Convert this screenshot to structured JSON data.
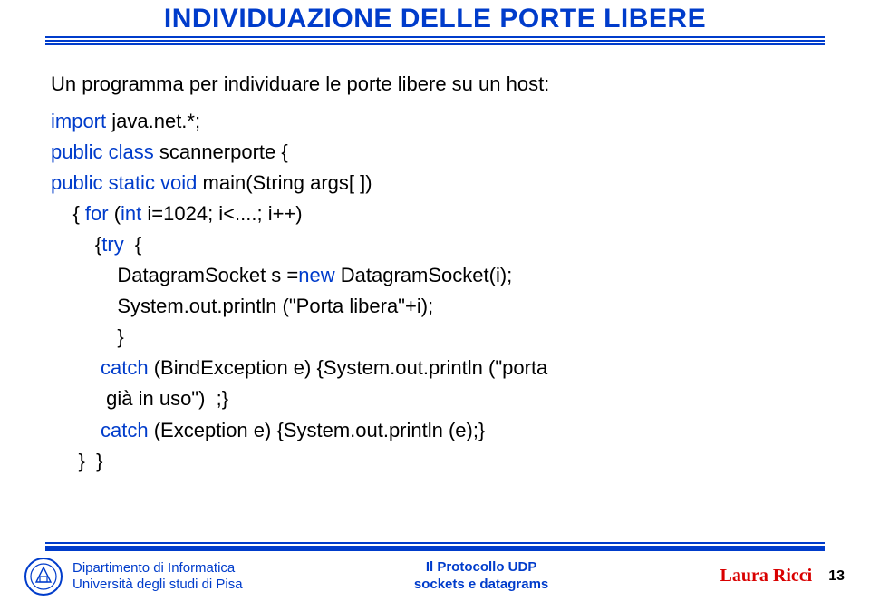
{
  "title": "INDIVIDUAZIONE DELLE PORTE LIBERE",
  "intro": "Un programma per individuare le porte libere su un host:",
  "code": {
    "l1a": "import ",
    "l1b": "java.net.*;",
    "l2a": "public class ",
    "l2b": "scannerporte {",
    "l3a": "public static void ",
    "l3b": "main(String args[ ])",
    "l4a": "    { ",
    "l4b": "for ",
    "l4c": "(",
    "l4d": "int ",
    "l4e": "i=1024; i<....; i++)",
    "l5a": "        {",
    "l5b": "try  ",
    "l5c": "{",
    "l6a": "            DatagramSocket s =",
    "l6b": "new ",
    "l6c": "DatagramSocket(i);",
    "l7": "            System.out.println (\"Porta libera\"+i);",
    "l8": "            }",
    "l9a": "         catch ",
    "l9b": "(BindException e) {System.out.println (\"porta",
    "l10a": "          già in uso\")  ;}",
    "l11a": "         catch ",
    "l11b": "(Exception e) {System.out.println (e);}",
    "l12": "     }  }"
  },
  "footer": {
    "dept1": "Dipartimento di Informatica",
    "dept2": "Università degli studi di Pisa",
    "center1": "Il Protocollo UDP",
    "center2": "sockets e datagrams",
    "author": "Laura Ricci",
    "page": "13"
  }
}
